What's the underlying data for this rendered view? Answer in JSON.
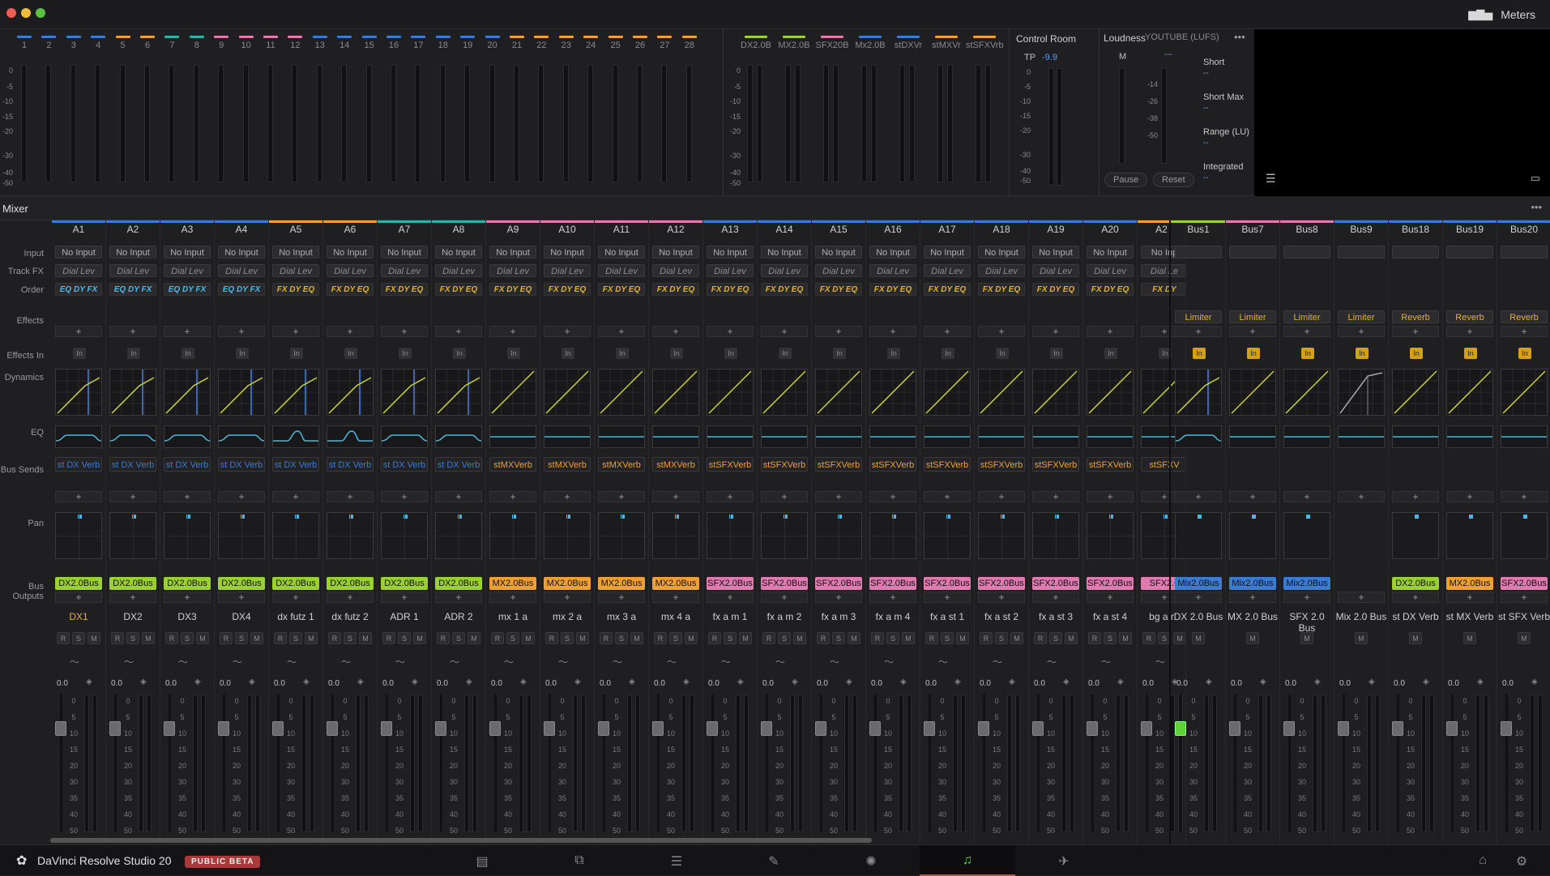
{
  "window": {
    "meters_label": "Meters"
  },
  "meters": {
    "tracks": [
      "1",
      "2",
      "3",
      "4",
      "5",
      "6",
      "7",
      "8",
      "9",
      "10",
      "11",
      "12",
      "13",
      "14",
      "15",
      "16",
      "17",
      "18",
      "19",
      "20",
      "21",
      "22",
      "23",
      "24",
      "25",
      "26",
      "27",
      "28"
    ],
    "track_colors": [
      "#3b7bd4",
      "#3b7bd4",
      "#3b7bd4",
      "#3b7bd4",
      "#f0a030",
      "#f0a030",
      "#2fb0a8",
      "#2fb0a8",
      "#e07ab0",
      "#e07ab0",
      "#e07ab0",
      "#e07ab0",
      "#3b7bd4",
      "#3b7bd4",
      "#3b7bd4",
      "#3b7bd4",
      "#3b7bd4",
      "#3b7bd4",
      "#3b7bd4",
      "#3b7bd4",
      "#f0a030",
      "#f0a030",
      "#f0a030",
      "#f0a030",
      "#f0a030",
      "#f0a030",
      "#f0a030",
      "#f0a030"
    ],
    "scale": [
      "0",
      "-5",
      "-10",
      "-15",
      "-20",
      "-30",
      "-40",
      "-50"
    ],
    "buses": [
      "DX2.0B",
      "MX2.0B",
      "SFX20B",
      "Mx2.0B",
      "stDXVr",
      "stMXVr",
      "stSFXVrb"
    ],
    "bus_colors": [
      "#9ad030",
      "#9ad030",
      "#e07ab0",
      "#3b7bd4",
      "#3b7bd4",
      "#f0a030",
      "#f0a030"
    ],
    "control_room": {
      "title": "Control Room",
      "tp_label": "TP",
      "tp_value": "-9.9"
    },
    "loudness": {
      "title": "Loudness",
      "standard": "YOUTUBE (LUFS)",
      "m_label": "M",
      "m_value": "---",
      "scale": [
        "-14",
        "-26",
        "-38",
        "-50"
      ],
      "fields": [
        {
          "label": "Short",
          "value": "--"
        },
        {
          "label": "Short Max",
          "value": "--"
        },
        {
          "label": "Range (LU)",
          "value": "--"
        },
        {
          "label": "Integrated",
          "value": "--"
        }
      ],
      "pause": "Pause",
      "reset": "Reset"
    }
  },
  "mixer": {
    "title": "Mixer",
    "row_labels": {
      "input": "Input",
      "track_fx": "Track FX",
      "order": "Order",
      "effects": "Effects",
      "effects_in": "Effects In",
      "dynamics": "Dynamics",
      "eq": "EQ",
      "bus_sends": "Bus Sends",
      "pan": "Pan",
      "bus_outputs": "Bus Outputs"
    },
    "strips": [
      {
        "id": "A1",
        "color": "#3b7bd4",
        "input": "No Input",
        "fx": "Dial Lev",
        "order": "EQ DY FX",
        "send": "st DX Verb",
        "send_color": "#3b7bd4",
        "out": "DX2.0Bus",
        "out_color": "#9ad030",
        "name": "DX1",
        "volume": "0.0",
        "dyn": "blue",
        "eq": "shelf"
      },
      {
        "id": "A2",
        "color": "#3b7bd4",
        "input": "No Input",
        "fx": "Dial Lev",
        "order": "EQ DY FX",
        "send": "st DX Verb",
        "send_color": "#3b7bd4",
        "out": "DX2.0Bus",
        "out_color": "#9ad030",
        "name": "DX2",
        "volume": "0.0",
        "dyn": "blue",
        "eq": "shelf"
      },
      {
        "id": "A3",
        "color": "#3b7bd4",
        "input": "No Input",
        "fx": "Dial Lev",
        "order": "EQ DY FX",
        "send": "st DX Verb",
        "send_color": "#3b7bd4",
        "out": "DX2.0Bus",
        "out_color": "#9ad030",
        "name": "DX3",
        "volume": "0.0",
        "dyn": "blue",
        "eq": "shelf"
      },
      {
        "id": "A4",
        "color": "#3b7bd4",
        "input": "No Input",
        "fx": "Dial Lev",
        "order": "EQ DY FX",
        "send": "st DX Verb",
        "send_color": "#3b7bd4",
        "out": "DX2.0Bus",
        "out_color": "#9ad030",
        "name": "DX4",
        "volume": "0.0",
        "dyn": "blue",
        "eq": "shelf"
      },
      {
        "id": "A5",
        "color": "#f0a030",
        "input": "No Input",
        "fx": "Dial Lev",
        "order": "FX DY EQ",
        "send": "st DX Verb",
        "send_color": "#3b7bd4",
        "out": "DX2.0Bus",
        "out_color": "#9ad030",
        "name": "dx futz 1",
        "volume": "0.0",
        "dyn": "blue",
        "eq": "peak"
      },
      {
        "id": "A6",
        "color": "#f0a030",
        "input": "No Input",
        "fx": "Dial Lev",
        "order": "FX DY EQ",
        "send": "st DX Verb",
        "send_color": "#3b7bd4",
        "out": "DX2.0Bus",
        "out_color": "#9ad030",
        "name": "dx futz 2",
        "volume": "0.0",
        "dyn": "blue",
        "eq": "peak"
      },
      {
        "id": "A7",
        "color": "#2fb0a8",
        "input": "No Input",
        "fx": "Dial Lev",
        "order": "FX DY EQ",
        "send": "st DX Verb",
        "send_color": "#3b7bd4",
        "out": "DX2.0Bus",
        "out_color": "#9ad030",
        "name": "ADR 1",
        "volume": "0.0",
        "dyn": "blue",
        "eq": "shelf"
      },
      {
        "id": "A8",
        "color": "#2fb0a8",
        "input": "No Input",
        "fx": "Dial Lev",
        "order": "FX DY EQ",
        "send": "st DX Verb",
        "send_color": "#3b7bd4",
        "out": "DX2.0Bus",
        "out_color": "#9ad030",
        "name": "ADR 2",
        "volume": "0.0",
        "dyn": "blue",
        "eq": "shelf"
      },
      {
        "id": "A9",
        "color": "#e07ab0",
        "input": "No Input",
        "fx": "Dial Lev",
        "order": "FX DY EQ",
        "send": "stMXVerb",
        "send_color": "#f0a030",
        "out": "MX2.0Bus",
        "out_color": "#f0a030",
        "name": "mx 1 a",
        "volume": "0.0",
        "dyn": "plain",
        "eq": "flat"
      },
      {
        "id": "A10",
        "color": "#e07ab0",
        "input": "No Input",
        "fx": "Dial Lev",
        "order": "FX DY EQ",
        "send": "stMXVerb",
        "send_color": "#f0a030",
        "out": "MX2.0Bus",
        "out_color": "#f0a030",
        "name": "mx 2 a",
        "volume": "0.0",
        "dyn": "plain",
        "eq": "flat"
      },
      {
        "id": "A11",
        "color": "#e07ab0",
        "input": "No Input",
        "fx": "Dial Lev",
        "order": "FX DY EQ",
        "send": "stMXVerb",
        "send_color": "#f0a030",
        "out": "MX2.0Bus",
        "out_color": "#f0a030",
        "name": "mx 3 a",
        "volume": "0.0",
        "dyn": "plain",
        "eq": "flat"
      },
      {
        "id": "A12",
        "color": "#e07ab0",
        "input": "No Input",
        "fx": "Dial Lev",
        "order": "FX DY EQ",
        "send": "stMXVerb",
        "send_color": "#f0a030",
        "out": "MX2.0Bus",
        "out_color": "#f0a030",
        "name": "mx 4 a",
        "volume": "0.0",
        "dyn": "plain",
        "eq": "flat"
      },
      {
        "id": "A13",
        "color": "#3b7bd4",
        "input": "No Input",
        "fx": "Dial Lev",
        "order": "FX DY EQ",
        "send": "stSFXVerb",
        "send_color": "#f0a030",
        "out": "SFX2.0Bus",
        "out_color": "#e07ab0",
        "name": "fx a m 1",
        "volume": "0.0",
        "dyn": "plain",
        "eq": "flat"
      },
      {
        "id": "A14",
        "color": "#3b7bd4",
        "input": "No Input",
        "fx": "Dial Lev",
        "order": "FX DY EQ",
        "send": "stSFXVerb",
        "send_color": "#f0a030",
        "out": "SFX2.0Bus",
        "out_color": "#e07ab0",
        "name": "fx a m 2",
        "volume": "0.0",
        "dyn": "plain",
        "eq": "flat"
      },
      {
        "id": "A15",
        "color": "#3b7bd4",
        "input": "No Input",
        "fx": "Dial Lev",
        "order": "FX DY EQ",
        "send": "stSFXVerb",
        "send_color": "#f0a030",
        "out": "SFX2.0Bus",
        "out_color": "#e07ab0",
        "name": "fx a m 3",
        "volume": "0.0",
        "dyn": "plain",
        "eq": "flat"
      },
      {
        "id": "A16",
        "color": "#3b7bd4",
        "input": "No Input",
        "fx": "Dial Lev",
        "order": "FX DY EQ",
        "send": "stSFXVerb",
        "send_color": "#f0a030",
        "out": "SFX2.0Bus",
        "out_color": "#e07ab0",
        "name": "fx a m 4",
        "volume": "0.0",
        "dyn": "plain",
        "eq": "flat"
      },
      {
        "id": "A17",
        "color": "#3b7bd4",
        "input": "No Input",
        "fx": "Dial Lev",
        "order": "FX DY EQ",
        "send": "stSFXVerb",
        "send_color": "#f0a030",
        "out": "SFX2.0Bus",
        "out_color": "#e07ab0",
        "name": "fx a st 1",
        "volume": "0.0",
        "dyn": "plain",
        "eq": "flat"
      },
      {
        "id": "A18",
        "color": "#3b7bd4",
        "input": "No Input",
        "fx": "Dial Lev",
        "order": "FX DY EQ",
        "send": "stSFXVerb",
        "send_color": "#f0a030",
        "out": "SFX2.0Bus",
        "out_color": "#e07ab0",
        "name": "fx a st 2",
        "volume": "0.0",
        "dyn": "plain",
        "eq": "flat"
      },
      {
        "id": "A19",
        "color": "#3b7bd4",
        "input": "No Input",
        "fx": "Dial Lev",
        "order": "FX DY EQ",
        "send": "stSFXVerb",
        "send_color": "#f0a030",
        "out": "SFX2.0Bus",
        "out_color": "#e07ab0",
        "name": "fx a st 3",
        "volume": "0.0",
        "dyn": "plain",
        "eq": "flat"
      },
      {
        "id": "A20",
        "color": "#3b7bd4",
        "input": "No Input",
        "fx": "Dial Lev",
        "order": "FX DY EQ",
        "send": "stSFXVerb",
        "send_color": "#f0a030",
        "out": "SFX2.0Bus",
        "out_color": "#e07ab0",
        "name": "fx a st 4",
        "volume": "0.0",
        "dyn": "plain",
        "eq": "flat"
      },
      {
        "id": "A2",
        "color": "#f0a030",
        "input": "No Inp",
        "fx": "Dial Le",
        "order": "FX DY",
        "send": "stSFXV",
        "send_color": "#f0a030",
        "out": "SFX2.0",
        "out_color": "#e07ab0",
        "name": "bg a r",
        "volume": "0.0",
        "dyn": "plain",
        "eq": "flat",
        "partial": true
      }
    ],
    "buses": [
      {
        "id": "Bus1",
        "color": "#9ad030",
        "effect": "Limiter",
        "out": "Mix2.0Bus",
        "out_color": "#3b7bd4",
        "name": "DX 2.0 Bus",
        "volume": "0.0",
        "dyn": "blue",
        "eq": "shelf",
        "pan": true,
        "fader_green": true
      },
      {
        "id": "Bus7",
        "color": "#e07ab0",
        "effect": "Limiter",
        "out": "Mix2.0Bus",
        "out_color": "#3b7bd4",
        "name": "MX 2.0 Bus",
        "volume": "0.0",
        "dyn": "plain",
        "eq": "flat",
        "pan": true
      },
      {
        "id": "Bus8",
        "color": "#e07ab0",
        "effect": "Limiter",
        "out": "Mix2.0Bus",
        "out_color": "#3b7bd4",
        "name": "SFX 2.0 Bus",
        "volume": "0.0",
        "dyn": "plain",
        "eq": "flat",
        "pan": true
      },
      {
        "id": "Bus9",
        "color": "#3b7bd4",
        "effect": "Limiter",
        "out": "",
        "out_color": "",
        "name": "Mix 2.0 Bus",
        "volume": "0.0",
        "dyn": "grey",
        "eq": "flat",
        "pan": false
      },
      {
        "id": "Bus18",
        "color": "#3b7bd4",
        "effect": "Reverb",
        "out": "DX2.0Bus",
        "out_color": "#9ad030",
        "name": "st DX Verb",
        "volume": "0.0",
        "dyn": "plain",
        "eq": "flat",
        "pan": true
      },
      {
        "id": "Bus19",
        "color": "#3b7bd4",
        "effect": "Reverb",
        "out": "MX2.0Bus",
        "out_color": "#f0a030",
        "name": "st MX Verb",
        "volume": "0.0",
        "dyn": "plain",
        "eq": "flat",
        "pan": true
      },
      {
        "id": "Bus20",
        "color": "#3b7bd4",
        "effect": "Reverb",
        "out": "SFX2.0Bus",
        "out_color": "#e07ab0",
        "name": "st SFX Verb",
        "volume": "0.0",
        "dyn": "plain",
        "eq": "flat",
        "pan": true
      }
    ],
    "rsm": [
      "R",
      "S",
      "M"
    ],
    "in_label": "In",
    "fader_scale": [
      "0",
      "5",
      "10",
      "15",
      "20",
      "30",
      "35",
      "40",
      "50"
    ]
  },
  "bottom": {
    "app_name": "DaVinci Resolve Studio 20",
    "badge": "PUBLIC BETA"
  }
}
